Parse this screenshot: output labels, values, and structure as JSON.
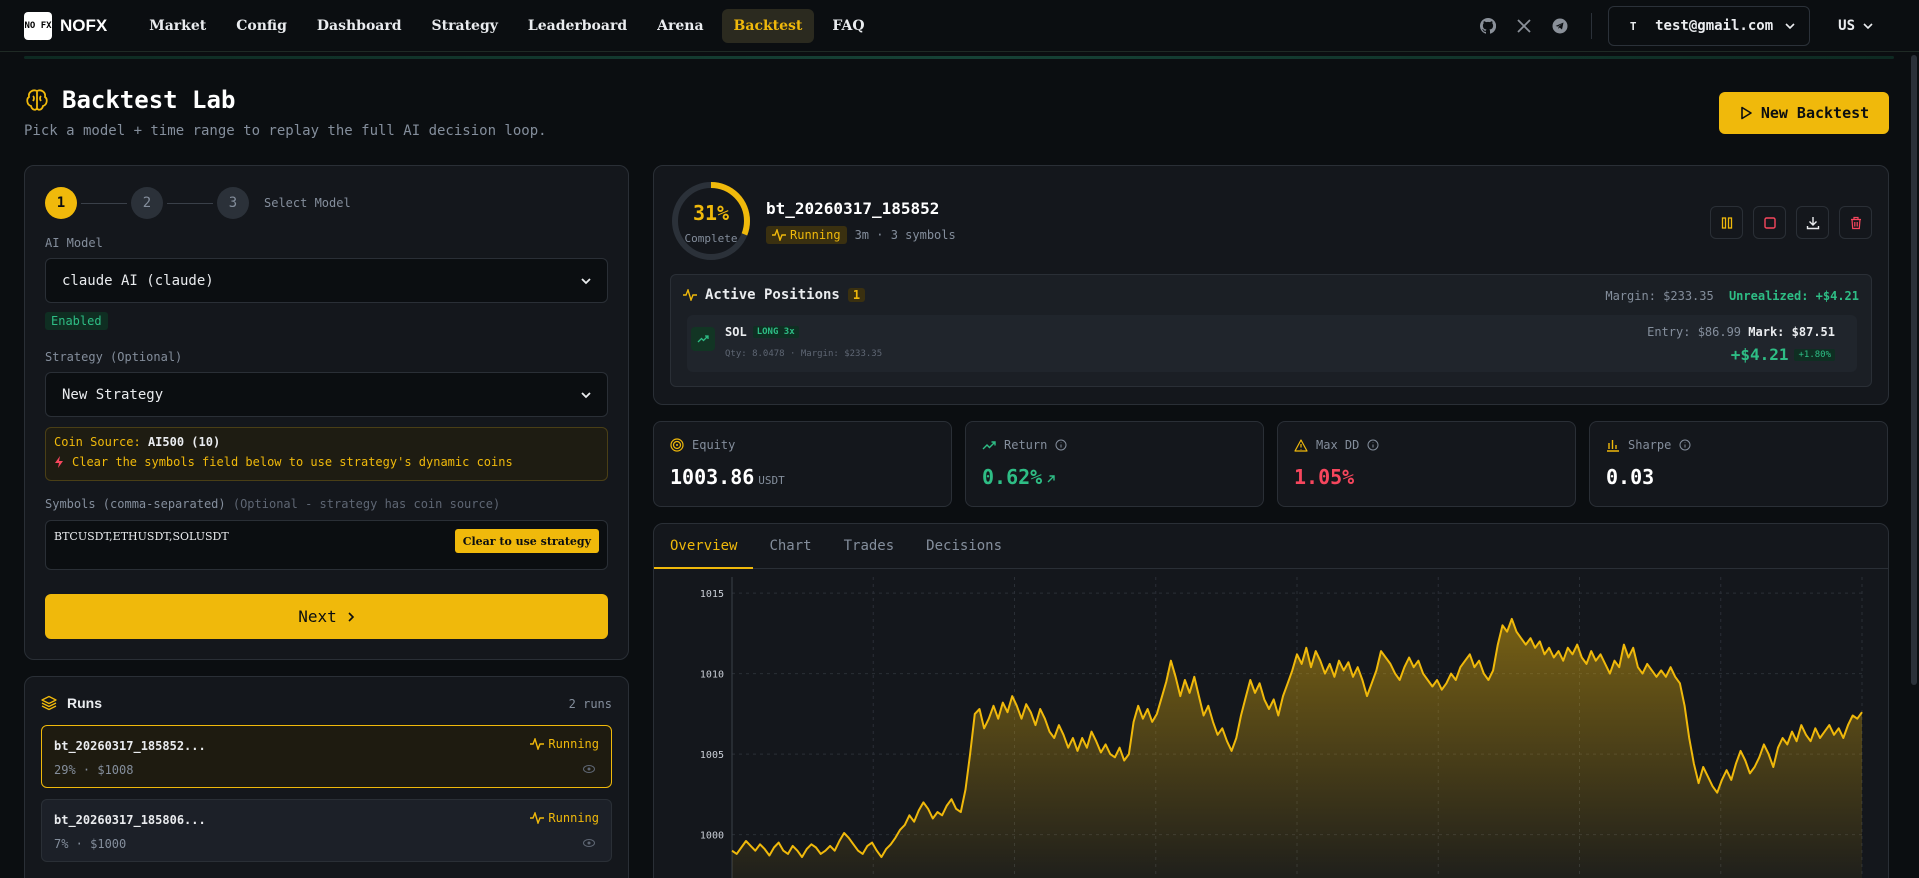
{
  "nav": {
    "logo_box": "NO FX",
    "logo_text": "NOFX",
    "items": [
      "Market",
      "Config",
      "Dashboard",
      "Strategy",
      "Leaderboard",
      "Arena",
      "Backtest",
      "FAQ"
    ],
    "active": "Backtest",
    "user_initial": "T",
    "user_email": "test@gmail.com",
    "lang": "US",
    "icons": [
      "github-icon",
      "x-icon",
      "telegram-icon"
    ]
  },
  "header": {
    "title": "Backtest Lab",
    "subtitle": "Pick a model + time range to replay the full AI decision loop.",
    "new_button": "New Backtest"
  },
  "wizard": {
    "steps": [
      "1",
      "2",
      "3"
    ],
    "step_label": "Select Model",
    "ai_model_label": "AI Model",
    "ai_model_value": "claude AI (claude)",
    "enabled": "Enabled",
    "strategy_label": "Strategy",
    "strategy_label_optional": "(Optional)",
    "strategy_value": "New Strategy",
    "coin_source_label": "Coin Source:",
    "coin_source_value": "AI500 (10)",
    "coin_hint": "Clear the symbols field below to use strategy's dynamic coins",
    "symbols_label": "Symbols (comma-separated)",
    "symbols_hint": "(Optional - strategy has coin source)",
    "symbols_value": "BTCUSDT,ETHUSDT,SOLUSDT",
    "clear_button": "Clear to use strategy",
    "next_button": "Next"
  },
  "runs": {
    "title": "Runs",
    "count": "2 runs",
    "items": [
      {
        "name": "bt_20260317_185852...",
        "meta": "29% · $1008",
        "status": "Running"
      },
      {
        "name": "bt_20260317_185806...",
        "meta": "7% · $1000",
        "status": "Running"
      }
    ]
  },
  "run_detail": {
    "progress": 0.31,
    "progress_label": "31%",
    "complete_label": "Complete",
    "id": "bt_20260317_185852",
    "status": "Running",
    "meta": "3m · 3 symbols"
  },
  "positions": {
    "title": "Active Positions",
    "count": "1",
    "margin_summary": "Margin: $233.35",
    "unrealized": "Unrealized: +$4.21",
    "items": [
      {
        "symbol": "SOL",
        "side": "LONG 3x",
        "qty": "Qty: 8.0478 · Margin: $233.35",
        "entry_label": "Entry:",
        "entry": "$86.99",
        "mark_label": "Mark:",
        "mark": "$87.51",
        "pnl": "+$4.21",
        "pnl_pct": "+1.80%"
      }
    ]
  },
  "stats": [
    {
      "label": "Equity",
      "value": "1003.86",
      "unit": "USDT",
      "color": "#ffffff"
    },
    {
      "label": "Return",
      "value": "0.62%",
      "unit": "",
      "color": "#2ebd85"
    },
    {
      "label": "Max DD",
      "value": "1.05%",
      "unit": "",
      "color": "#f6465d"
    },
    {
      "label": "Sharpe",
      "value": "0.03",
      "unit": "",
      "color": "#ffffff"
    }
  ],
  "tabs": [
    "Overview",
    "Chart",
    "Trades",
    "Decisions"
  ],
  "colors": {
    "accent": "#f0b90b",
    "green": "#2ebd85",
    "red": "#f6465d",
    "bg": "#0b0e11"
  },
  "chart_data": {
    "type": "area",
    "title": "",
    "xlabel": "",
    "ylabel": "",
    "ylim": [
      996,
      1016
    ],
    "yticks": [
      1000,
      1005,
      1010,
      1015
    ],
    "grid": true,
    "series": [
      {
        "values": [
          999.0,
          998.8,
          999.2,
          999.6,
          999.3,
          999.0,
          999.4,
          999.1,
          998.7,
          999.2,
          999.5,
          999.0,
          998.8,
          999.3,
          999.0,
          998.6,
          999.1,
          999.4,
          999.2,
          998.8,
          999.0,
          999.3,
          999.0,
          999.6,
          1000.1,
          999.8,
          999.4,
          999.0,
          998.8,
          999.3,
          999.5,
          999.0,
          998.6,
          999.1,
          999.4,
          999.8,
          1000.3,
          1000.6,
          1001.2,
          1000.8,
          1001.5,
          1002.0,
          1001.6,
          1001.0,
          1001.4,
          1001.2,
          1001.8,
          1002.2,
          1001.6,
          1001.4,
          1002.8,
          1005.0,
          1007.5,
          1007.8,
          1006.6,
          1007.2,
          1008.0,
          1007.2,
          1008.2,
          1007.6,
          1008.6,
          1008.0,
          1007.2,
          1008.1,
          1007.6,
          1006.8,
          1007.8,
          1007.2,
          1006.4,
          1006.0,
          1006.8,
          1006.2,
          1005.4,
          1006.0,
          1005.2,
          1006.0,
          1005.4,
          1006.4,
          1005.8,
          1005.1,
          1005.6,
          1005.0,
          1004.8,
          1005.4,
          1004.6,
          1005.0,
          1007.0,
          1008.0,
          1007.2,
          1007.8,
          1007.0,
          1007.5,
          1008.5,
          1009.5,
          1010.8,
          1009.8,
          1008.6,
          1009.6,
          1008.8,
          1009.8,
          1008.6,
          1007.4,
          1008.0,
          1007.0,
          1006.2,
          1006.6,
          1005.8,
          1005.2,
          1006.0,
          1007.4,
          1008.5,
          1009.6,
          1008.8,
          1009.4,
          1008.4,
          1007.8,
          1008.4,
          1007.4,
          1008.6,
          1009.4,
          1010.2,
          1011.2,
          1010.6,
          1011.6,
          1010.4,
          1011.4,
          1010.8,
          1010.0,
          1010.6,
          1009.8,
          1010.8,
          1010.2,
          1010.7,
          1009.8,
          1010.4,
          1009.6,
          1008.6,
          1009.4,
          1010.2,
          1011.4,
          1011.0,
          1010.6,
          1010.0,
          1009.6,
          1010.4,
          1011.0,
          1010.4,
          1010.8,
          1010.0,
          1009.6,
          1009.2,
          1009.6,
          1009.0,
          1009.4,
          1010.0,
          1009.6,
          1010.4,
          1010.8,
          1011.2,
          1010.4,
          1010.8,
          1010.0,
          1009.6,
          1010.2,
          1011.8,
          1013.0,
          1012.6,
          1013.4,
          1012.6,
          1012.2,
          1011.8,
          1012.2,
          1011.6,
          1012.0,
          1011.2,
          1011.6,
          1011.0,
          1011.4,
          1010.8,
          1011.6,
          1011.2,
          1011.8,
          1011.0,
          1010.6,
          1011.4,
          1010.8,
          1011.2,
          1010.6,
          1010.0,
          1010.8,
          1010.4,
          1011.8,
          1011.0,
          1011.6,
          1010.4,
          1010.0,
          1010.6,
          1010.2,
          1009.8,
          1010.2,
          1009.8,
          1010.4,
          1009.8,
          1009.4,
          1008.0,
          1006.0,
          1004.4,
          1003.2,
          1004.2,
          1003.6,
          1003.0,
          1002.6,
          1003.4,
          1004.0,
          1003.4,
          1004.4,
          1005.2,
          1004.6,
          1003.8,
          1004.2,
          1004.8,
          1005.6,
          1005.0,
          1004.2,
          1005.4,
          1006.0,
          1005.6,
          1006.4,
          1005.8,
          1006.8,
          1006.2,
          1005.8,
          1006.6,
          1006.0,
          1006.4,
          1006.8,
          1006.2,
          1006.6,
          1006.0,
          1006.8,
          1007.4,
          1007.2,
          1007.6
        ]
      }
    ]
  }
}
